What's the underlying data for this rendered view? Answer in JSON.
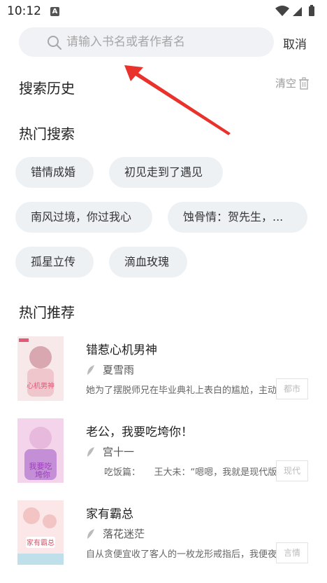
{
  "status_bar": {
    "time": "10:12",
    "notification_letter": "A"
  },
  "search": {
    "placeholder": "请输入书名或者作者名",
    "cancel_label": "取消"
  },
  "history": {
    "title": "搜索历史",
    "clear_label": "清空"
  },
  "hot_search": {
    "title": "热门搜索",
    "chips": [
      "错情成婚",
      "初见走到了遇见",
      "南风过境，你过我心",
      "蚀骨情：贺先生，...",
      "孤星立传",
      "滴血玫瑰"
    ]
  },
  "recommend": {
    "title": "热门推荐",
    "books": [
      {
        "title": "错惹心机男神",
        "author": "夏雪雨",
        "desc": "她为了摆脱师兄在毕业典礼上表白的尴尬，主动",
        "tag": "都市",
        "cover_text": "错惹心机男神",
        "cover_colors": [
          "#f7e9ea",
          "#d8a7b0",
          "#e35a79"
        ]
      },
      {
        "title": "老公，我要吃垮你！",
        "author": "宫十一",
        "desc": "　　吃饭篇：　　王大未：“嗯嗯，我就是现代版",
        "tag": "现代",
        "cover_text": "我要吃垮你",
        "cover_colors": [
          "#f4d4ea",
          "#c48fd6",
          "#9b3fb8"
        ]
      },
      {
        "title": "家有霸总",
        "author": "落花迷茫",
        "desc": "自从贪便宜收了客人的一枚龙形戒指后，我便夜",
        "tag": "言情",
        "cover_text": "家有霸总",
        "cover_colors": [
          "#fbe7e7",
          "#f3c4c4",
          "#c95a6a"
        ]
      }
    ]
  }
}
